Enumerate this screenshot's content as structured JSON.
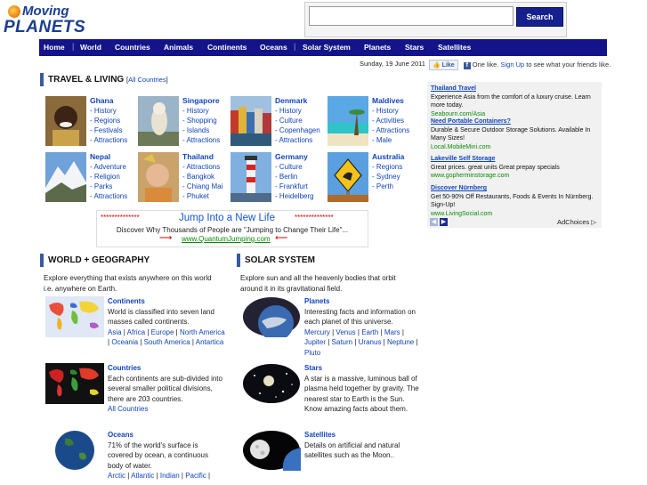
{
  "logo": {
    "line1": "Moving",
    "line2": "PLANETS"
  },
  "search": {
    "value": "",
    "button": "Search"
  },
  "nav": [
    "Home",
    "World",
    "Countries",
    "Animals",
    "Continents",
    "Oceans",
    "Solar System",
    "Planets",
    "Stars",
    "Satellites"
  ],
  "date": "Sunday, 19 June 2011",
  "facebook": {
    "like": "Like",
    "text_pre": "One like.",
    "signup": "Sign Up",
    "text_post": "to see what your friends like."
  },
  "travel": {
    "title": "TRAVEL & LIVING",
    "all_countries": "All Countries",
    "countries": [
      {
        "name": "Ghana",
        "links": [
          "- History",
          "- Regions",
          "- Festivals",
          "- Attractions"
        ]
      },
      {
        "name": "Singapore",
        "links": [
          "- History",
          "- Shopping",
          "- Islands",
          "- Attractions"
        ]
      },
      {
        "name": "Denmark",
        "links": [
          "- History",
          "- Culture",
          "- Copenhagen",
          "- Attractions"
        ]
      },
      {
        "name": "Maldives",
        "links": [
          "- History",
          "- Activities",
          "- Attractions",
          "- Male"
        ]
      },
      {
        "name": "Nepal",
        "links": [
          "- Adventure",
          "- Religion",
          "- Parks",
          "- Attractions"
        ]
      },
      {
        "name": "Thailand",
        "links": [
          "- Attractions",
          "- Bangkok",
          "- Chiang Mai",
          "- Phuket"
        ]
      },
      {
        "name": "Germany",
        "links": [
          "- Culture",
          "- Berlin",
          "- Frankfurt",
          "- Heidelberg"
        ]
      },
      {
        "name": "Australia",
        "links": [
          "- Regions",
          "- Sydney",
          "- Perth"
        ]
      }
    ]
  },
  "ads": [
    {
      "title": "Thailand Travel",
      "text": "Experience Asia from the comfort of a luxury cruise. Learn more today.",
      "url": "Seabourn.com/Asia"
    },
    {
      "title": "Need Portable Containers?",
      "text": "Durable & Secure Outdoor Storage Solutions. Available In Many Sizes!",
      "url": "Local.MobileMini.com"
    },
    {
      "title": "Lakeville Self Storage",
      "text": "Great prices. great units Great prepay specials",
      "url": "www.gopherminstorage.com"
    },
    {
      "title": "Discover Nürnberg",
      "text": "Get 50-90% Off Restaurants, Foods & Events In Nürnberg. Sign-Up!",
      "url": "www.LivingSocial.com"
    }
  ],
  "adchoices": "AdChoices",
  "banner": {
    "stars": "**************",
    "title": "Jump Into a New Life",
    "text": "Discover Why Thousands of People are \"Jumping to Change Their Life\"...",
    "url": "www.QuantumJumping.com"
  },
  "world": {
    "title": "WORLD + GEOGRAPHY",
    "intro": "Explore everything that exists anywhere on this world i.e. anywhere on Earth.",
    "blocks": [
      {
        "title": "Continents",
        "text": "World is classified into seven land masses called continents.",
        "links": [
          "Asia",
          "Africa",
          "Europe",
          "North America",
          "Oceania",
          "South America",
          "Antartica"
        ]
      },
      {
        "title": "Countries",
        "text": "Each continents are sub-divided into several smaller political divisions, there are 203 countries.",
        "links": [
          "All Countries"
        ]
      },
      {
        "title": "Oceans",
        "text": "71% of the world's surface is covered by ocean, a continuous body of water.",
        "links": [
          "Arctic",
          "Atlantic",
          "Indian",
          "Pacific"
        ]
      }
    ]
  },
  "solar": {
    "title": "SOLAR SYSTEM",
    "intro": "Explore sun and all the heavenly bodies that orbit around it in its gravitational field.",
    "blocks": [
      {
        "title": "Planets",
        "text": "Interesting facts and information on each planet of this universe.",
        "links": [
          "Mercury",
          "Venus",
          "Earth",
          "Mars",
          "Jupiter",
          "Saturn",
          "Uranus",
          "Neptune",
          "Pluto"
        ]
      },
      {
        "title": "Stars",
        "text": "A star is a massive, luminous ball of plasma held together by gravity. The nearest star to Earth is the Sun. Know amazing facts about them.",
        "links": []
      },
      {
        "title": "Satellites",
        "text": "Details on artificial and natural satellites such as the Moon..",
        "links": []
      }
    ]
  }
}
